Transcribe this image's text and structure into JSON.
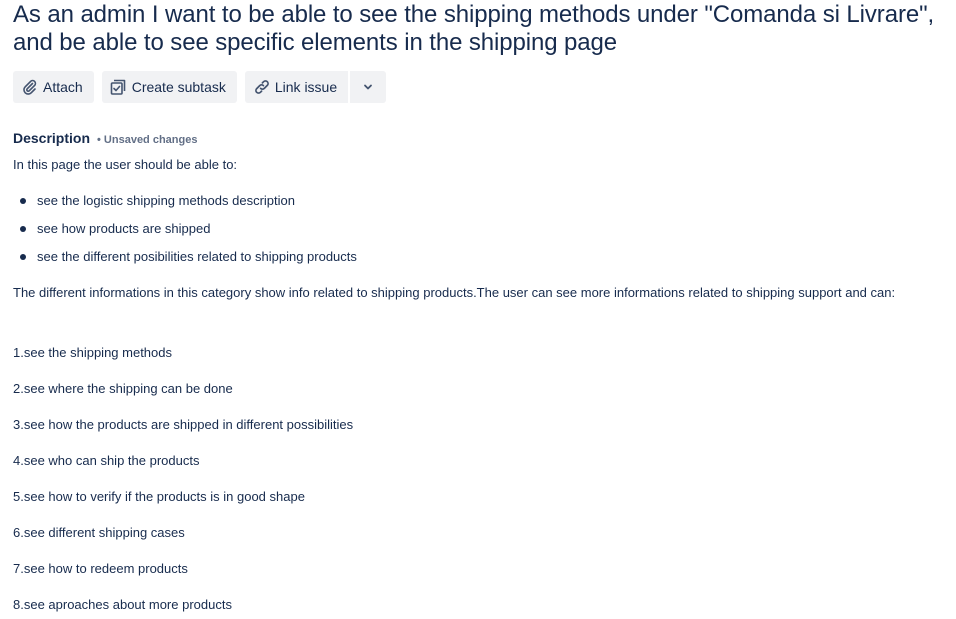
{
  "issue": {
    "title": "As an admin I want to be able to see the shipping methods under \"Comanda si Livrare\", and be able to see specific elements in the shipping page"
  },
  "toolbar": {
    "attach_label": "Attach",
    "create_subtask_label": "Create subtask",
    "link_issue_label": "Link issue",
    "attach_icon": "paperclip-icon",
    "subtask_icon": "subtask-icon",
    "link_icon": "link-icon",
    "more_icon": "chevron-down-icon"
  },
  "description": {
    "label": "Description",
    "status": "• Unsaved changes",
    "intro": "In this page the user should be able to:",
    "bullets": [
      "see the logistic shipping methods description",
      "see how products are shipped",
      "see the different posibilities related to shipping products"
    ],
    "paragraph": "The different informations in this category show info related to shipping products.The user can see more informations related to shipping support and can:",
    "steps": [
      "1.see the shipping methods",
      "2.see where the shipping can be done",
      "3.see how the products are shipped in different possibilities",
      "4.see who can ship the products",
      "5.see how to verify if the products is in good shape",
      "6.see different shipping cases",
      "7.see how to redeem products",
      "8.see aproaches about more products"
    ]
  }
}
